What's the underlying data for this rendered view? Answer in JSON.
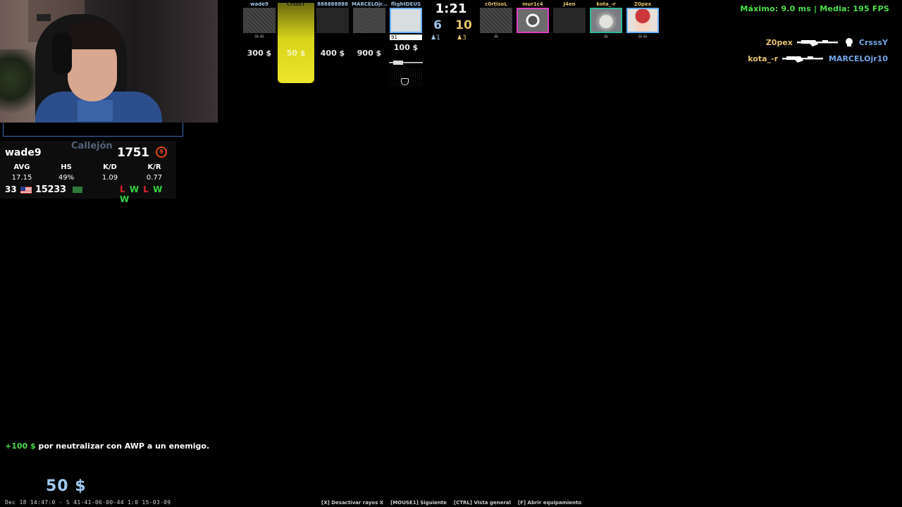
{
  "perf": {
    "text": "Máximo:   9.0 ms | Media:  195 FPS"
  },
  "stats_panel": {
    "player": "wade9",
    "map": "Callejón",
    "elo": "1751",
    "level": "9",
    "headers": [
      "AVG",
      "HS",
      "K/D",
      "K/R"
    ],
    "values": [
      "17.15",
      "49%",
      "1.09",
      "0.77"
    ],
    "rank_number": "33",
    "points": "15233",
    "results": [
      "L",
      "W",
      "L",
      "W",
      "W"
    ]
  },
  "scoreboard": {
    "timer": "1:21",
    "ct_score": "6",
    "t_score": "10",
    "ct_alive": "♟1",
    "t_alive": "♟3",
    "ct_players": [
      {
        "name": "wade9",
        "money": "300  $",
        "icon": "☠☠"
      },
      {
        "name": "CrsssY",
        "money": "50  $",
        "icon": ""
      },
      {
        "name": "888888888",
        "money": "400  $",
        "icon": ""
      },
      {
        "name": "MARCELOjr...",
        "money": "900  $",
        "icon": ""
      },
      {
        "name": "flightDEUS",
        "money": "100  $",
        "icon": "",
        "hp": "91"
      }
    ],
    "t_players": [
      {
        "name": "c0rtisoL",
        "icon": "☠"
      },
      {
        "name": "mur1c4",
        "icon": ""
      },
      {
        "name": "J4en",
        "icon": ""
      },
      {
        "name": "kota_-r",
        "icon": "☠"
      },
      {
        "name": "Z0pex",
        "icon": "☠☠"
      }
    ],
    "colors": {
      "ct": "#9fc3e6",
      "t": "#e3c26a",
      "highlight": "#d8d41a"
    }
  },
  "killfeed": [
    {
      "killer": "Z0pex",
      "victim": "CrsssY",
      "weapon": "rifle-icon",
      "headshot": true
    },
    {
      "killer": "kota_-r",
      "victim": "MARCELOjr10",
      "weapon": "rifle-icon",
      "headshot": false
    }
  ],
  "reward": {
    "amount": "+100 $",
    "text": " por neutralizar con AWP a un enemigo."
  },
  "money": "50  $",
  "demo_info": "Dec 18 14:47:0 - S 41-41-06-00-44 1:0 15-03-09",
  "hints": [
    "[X] Desactivar rayos X",
    "[MOUSE1] Siguiente",
    "[CTRL] Vista general",
    "[F] Abrir equipamiento"
  ]
}
